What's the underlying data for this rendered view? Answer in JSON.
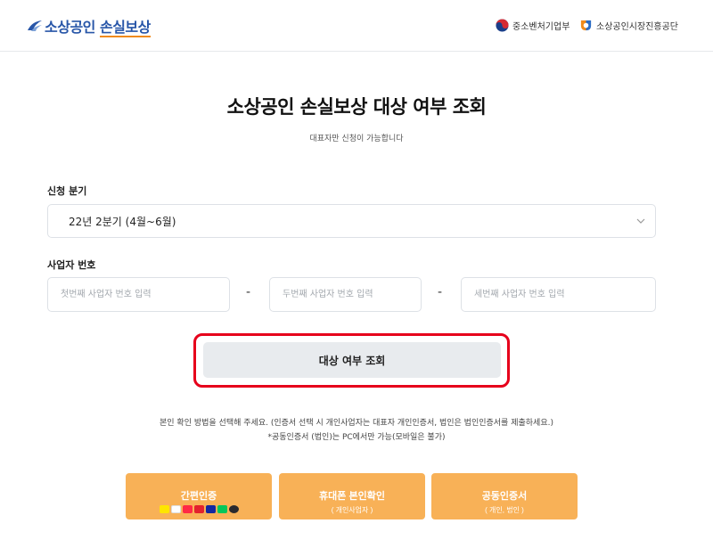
{
  "header": {
    "logo_text_1": "소상공인",
    "logo_text_2": "손실보상",
    "agency_1": "중소벤처기업부",
    "agency_2": "소상공인시장진흥공단"
  },
  "main": {
    "title": "소상공인 손실보상 대상 여부 조회",
    "subtitle": "대표자만 신청이 가능합니다",
    "quarter_label": "신청 분기",
    "quarter_selected": "22년 2분기 (4월~6월)",
    "bizno_label": "사업자 번호",
    "bizno_placeholder_1": "첫번째 사업자 번호 입력",
    "bizno_placeholder_2": "두번째 사업자 번호 입력",
    "bizno_placeholder_3": "세번째 사업자 번호 입력",
    "dash": "-",
    "search_button": "대상 여부 조회",
    "notice_1": "본인 확인 방법을 선택해 주세요. (인증서 선택 시 개인사업자는 대표자 개인인증서, 법인은 법인인증서를 제출하세요.)",
    "notice_2": "*공동인증서 (법인)는 PC에서만 가능(모바일은 불가)"
  },
  "auth": {
    "simple_label": "간편인증",
    "phone_label": "휴대폰 본인확인",
    "phone_sub": "( 개인사업자 )",
    "cert_label": "공동인증서",
    "cert_sub": "( 개인, 법인 )",
    "app_icons": [
      "kakao",
      "toss",
      "payco",
      "pass",
      "samsung",
      "naver",
      "kb"
    ]
  },
  "colors": {
    "brand_blue": "#2856a8",
    "accent_orange": "#f8b157",
    "highlight_red": "#e6001b"
  }
}
